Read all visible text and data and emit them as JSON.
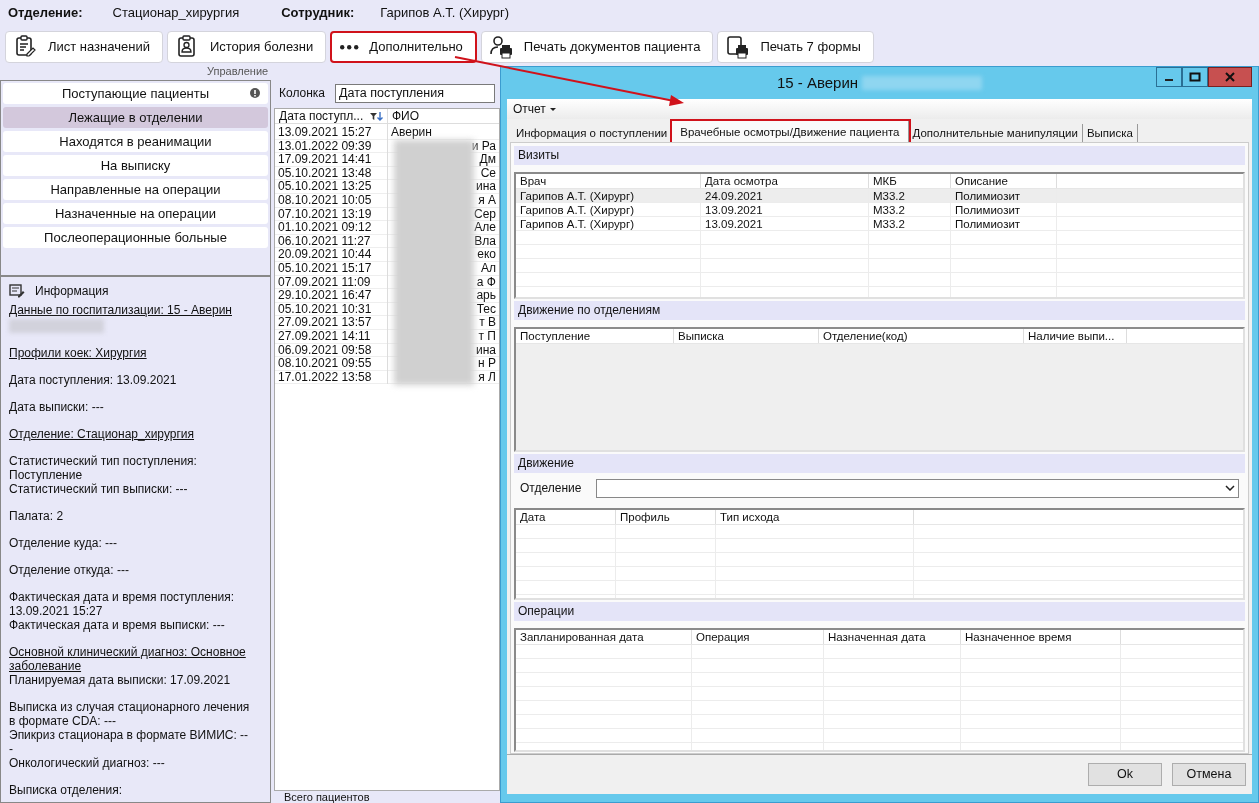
{
  "header": {
    "department_label": "Отделение:",
    "department": "Стационар_хирургия",
    "employee_label": "Сотрудник:",
    "employee": "Гарипов А.Т. (Хирург)"
  },
  "toolbar": {
    "group_label": "Управление",
    "buttons": [
      {
        "kind": "clipboard",
        "label": "Лист назначений",
        "highlighted": false
      },
      {
        "kind": "badge",
        "label": "История болезни",
        "highlighted": false
      },
      {
        "kind": "dots",
        "label": "Дополнительно",
        "highlighted": true
      },
      {
        "kind": "person-printer",
        "label": "Печать документов пациента",
        "highlighted": false
      },
      {
        "kind": "page-printer",
        "label": "Печать 7 формы",
        "highlighted": false
      }
    ]
  },
  "categories": [
    {
      "label": "Поступающие пациенты",
      "selected": false,
      "alert": true
    },
    {
      "label": "Лежащие в отделении",
      "selected": true,
      "alert": false
    },
    {
      "label": "Находятся в реанимации",
      "selected": false,
      "alert": false
    },
    {
      "label": "На выписку",
      "selected": false,
      "alert": false
    },
    {
      "label": "Направленные на операции",
      "selected": false,
      "alert": false
    },
    {
      "label": "Назначенные на операции",
      "selected": false,
      "alert": false
    },
    {
      "label": "Послеоперационные больные",
      "selected": false,
      "alert": false
    }
  ],
  "info": {
    "title": "Информация",
    "blocks": [
      [
        {
          "kind": "link",
          "text": "Данные по госпитализации: 15 - Аверин ",
          "redacted_after": true
        }
      ],
      [
        {
          "kind": "link",
          "text": "Профили коек: Хирургия"
        }
      ],
      [
        {
          "kind": "text",
          "text": "Дата поступления: 13.09.2021"
        }
      ],
      [
        {
          "kind": "text",
          "text": "Дата выписки: ---"
        }
      ],
      [
        {
          "kind": "link",
          "text": "Отделение: Стационар_хирургия"
        }
      ],
      [
        {
          "kind": "text",
          "text": "Статистический тип поступления: Поступление"
        },
        {
          "kind": "text",
          "text": "Статистический тип выписки: ---"
        }
      ],
      [
        {
          "kind": "text",
          "text": "Палата: 2"
        }
      ],
      [
        {
          "kind": "text",
          "text": "Отделение куда: ---"
        }
      ],
      [
        {
          "kind": "text",
          "text": "Отделение откуда: ---"
        }
      ],
      [
        {
          "kind": "text",
          "text": "Фактическая дата и время поступления: 13.09.2021 15:27"
        },
        {
          "kind": "text",
          "text": "Фактическая дата и время выписки: ---"
        }
      ],
      [
        {
          "kind": "link",
          "text": "Основной клинический диагноз: Основное заболевание"
        },
        {
          "kind": "text",
          "text": "Планируемая дата выписки: 17.09.2021"
        }
      ],
      [
        {
          "kind": "text",
          "text": "Выписка из случая стационарного лечения в формате CDA: ---"
        },
        {
          "kind": "text",
          "text": "Эпикриз стационара в формате ВИМИС: ---"
        },
        {
          "kind": "text",
          "text": "Онкологический диагноз: ---"
        }
      ],
      [
        {
          "kind": "text",
          "text": "Выписка отделения:"
        }
      ]
    ]
  },
  "patients": {
    "filter_label": "Колонка",
    "filter_value": "Дата поступления",
    "columns": [
      "Дата поступл...",
      "ФИО"
    ],
    "status": "Всего пациентов",
    "rows": [
      {
        "date": "13.09.2021 15:27",
        "fio": "Аверин"
      },
      {
        "date": "13.01.2022 09:39",
        "fio": "и Ра"
      },
      {
        "date": "17.09.2021 14:41",
        "fio": "Дм"
      },
      {
        "date": "05.10.2021 13:48",
        "fio": "Се"
      },
      {
        "date": "05.10.2021 13:25",
        "fio": "ина"
      },
      {
        "date": "08.10.2021 10:05",
        "fio": "я А"
      },
      {
        "date": "07.10.2021 13:19",
        "fio": "Сер"
      },
      {
        "date": "01.10.2021 09:12",
        "fio": "Але"
      },
      {
        "date": "06.10.2021 11:27",
        "fio": "Вла"
      },
      {
        "date": "20.09.2021 10:44",
        "fio": "еко"
      },
      {
        "date": "05.10.2021 15:17",
        "fio": "Ал"
      },
      {
        "date": "07.09.2021 11:09",
        "fio": "а Ф"
      },
      {
        "date": "29.10.2021 16:47",
        "fio": "арь"
      },
      {
        "date": "05.10.2021 10:31",
        "fio": "Тес"
      },
      {
        "date": "27.09.2021 13:57",
        "fio": "т В"
      },
      {
        "date": "27.09.2021 14:11",
        "fio": "т П"
      },
      {
        "date": "06.09.2021 09:58",
        "fio": "ина"
      },
      {
        "date": "08.10.2021 09:55",
        "fio": "н Р"
      },
      {
        "date": "17.01.2022 13:58",
        "fio": "я Л"
      }
    ]
  },
  "dialog": {
    "title": "15 - Аверин",
    "menu": "Отчет",
    "tabs": [
      {
        "label": "Информация о поступлении",
        "selected": false,
        "highlighted": false
      },
      {
        "label": "Врачебные осмотры/Движение пациента",
        "selected": true,
        "highlighted": true
      },
      {
        "label": "Дополнительные манипуляции",
        "selected": false,
        "highlighted": false
      },
      {
        "label": "Выписка",
        "selected": false,
        "highlighted": false
      }
    ],
    "sections": [
      {
        "kind": "grid",
        "title": "Визиты",
        "columns": [
          "Врач",
          "Дата осмотра",
          "МКБ",
          "Описание"
        ],
        "rows": [
          {
            "selected": true,
            "cells": [
              "Гарипов А.Т. (Хирург)",
              "24.09.2021",
              "M33.2",
              "Полимиозит"
            ]
          },
          {
            "selected": false,
            "cells": [
              "Гарипов А.Т. (Хирург)",
              "13.09.2021",
              "M33.2",
              "Полимиозит"
            ]
          },
          {
            "selected": false,
            "cells": [
              "Гарипов А.Т. (Хирург)",
              "13.09.2021",
              "M33.2",
              "Полимиозит"
            ]
          }
        ]
      },
      {
        "kind": "blank",
        "title": "Движение по отделениям",
        "columns": [
          "Поступление",
          "Выписка",
          "Отделение(код)",
          "Наличие выпи..."
        ]
      },
      {
        "kind": "grid",
        "title": "Движение",
        "field_label": "Отделение",
        "columns": [
          "Дата",
          "Профиль",
          "Тип исхода"
        ]
      },
      {
        "kind": "grid",
        "title": "Операции",
        "columns": [
          "Запланированная дата",
          "Операция",
          "Назначенная дата",
          "Назначенное время"
        ]
      }
    ],
    "buttons": [
      "Ok",
      "Отмена"
    ]
  }
}
